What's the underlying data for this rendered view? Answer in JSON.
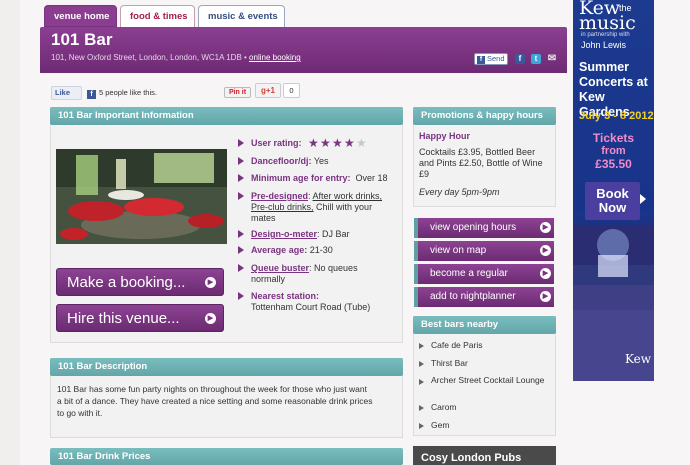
{
  "tabs": [
    "venue home",
    "food & times",
    "music & events"
  ],
  "venue": {
    "name": "101 Bar",
    "address": "101, New Oxford Street, London, London, WC1A 1DB •",
    "booking_link": "online booking"
  },
  "share": {
    "send": "Send",
    "fb": "f",
    "tw": "t",
    "mail": "✉"
  },
  "social": {
    "like": "Like",
    "likes_text": "5 people like this.",
    "pinit": "Pin it",
    "gplus": "+1",
    "gplus_count": "0"
  },
  "info": {
    "heading": "101 Bar Important Information",
    "rating_label": "User rating:",
    "rating": 4,
    "rating_max": 5,
    "dance_label": "Dancefloor/dj:",
    "dance": "Yes",
    "age_label": "Minimum age for entry:",
    "age": "Over 18",
    "predesigned_label": "Pre-designed",
    "predesigned_links": [
      "After work drinks,",
      "Pre-club drinks,"
    ],
    "predesigned_rest": "Chill with your",
    "predesigned_tail": "mates",
    "designometer_label": "Design-o-meter",
    "designometer": "DJ Bar",
    "avgage_label": "Average age:",
    "avgage": "21-30",
    "queue_label": "Queue buster",
    "queue": "No queues",
    "queue_tail": "normally",
    "station_label": "Nearest station:",
    "station": "Tottenham Court Road (Tube)"
  },
  "buttons": {
    "booking": "Make a booking...",
    "hire": "Hire this venue..."
  },
  "description": {
    "heading": "101 Bar Description",
    "lines": [
      "101 Bar has some fun party nights on throughout the week for those who just want",
      "a bit of a dance. They have created a nice setting and some reasonable drink prices",
      "to go with it."
    ]
  },
  "prices": {
    "heading": "101 Bar Drink Prices"
  },
  "promotions": {
    "heading": "Promotions & happy hours",
    "title": "Happy Hour",
    "lines": [
      "Cocktails £3.95, Bottled Beer",
      "and Pints £2.50, Bottle of Wine",
      "£9"
    ],
    "note": "Every day 5pm-9pm"
  },
  "actions": [
    "view opening hours",
    "view on map",
    "become a regular",
    "add to nightplanner"
  ],
  "nearby": {
    "heading": "Best bars nearby",
    "items": [
      "Cafe de Paris",
      "Thirst Bar",
      "Archer Street Cocktail Lounge",
      "Carom",
      "Gem"
    ]
  },
  "cosy": "Cosy London Pubs",
  "ad": {
    "brand": "Kew",
    "brand_the": "the",
    "brand2": "music",
    "partner": "in partnership with",
    "partner2": "John Lewis",
    "line1": "Summer",
    "line2": "Concerts at",
    "line3": "Kew Gardens",
    "dates": "July 3 - 8 2012",
    "tickets1": "Tickets",
    "tickets2": "from",
    "price": "£35.50",
    "book1": "Book",
    "book2": "Now",
    "logo": "Kew"
  }
}
